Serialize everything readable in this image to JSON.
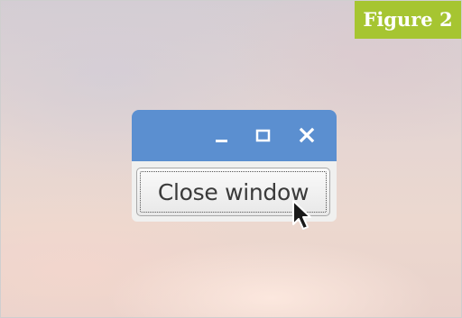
{
  "figure_label": "Figure 2",
  "window": {
    "titlebar_color": "#5b8fd0",
    "controls": {
      "minimize_icon": "minimize-icon",
      "maximize_icon": "maximize-icon",
      "close_icon": "close-icon"
    },
    "button": {
      "label": "Close window"
    }
  },
  "colors": {
    "badge": "#a6c531"
  },
  "cursor_icon": "arrow-pointer-icon"
}
